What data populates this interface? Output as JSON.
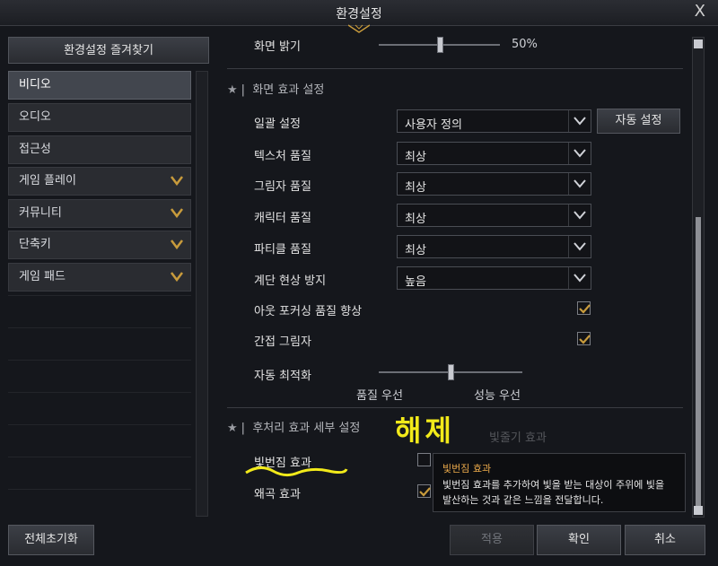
{
  "window": {
    "title": "환경설정",
    "close_glyph": "X"
  },
  "sidebar": {
    "favorites_button": "환경설정 즐겨찾기",
    "items": [
      {
        "label": "비디오",
        "active": true
      },
      {
        "label": "오디오",
        "active": false
      },
      {
        "label": "접근성",
        "active": false
      },
      {
        "label": "게임 플레이",
        "active": false,
        "has_chevron": true
      },
      {
        "label": "커뮤니티",
        "active": false,
        "has_chevron": true
      },
      {
        "label": "단축키",
        "active": false,
        "has_chevron": true
      },
      {
        "label": "게임 패드",
        "active": false,
        "has_chevron": true
      }
    ]
  },
  "main": {
    "brightness": {
      "label": "화면 밝기",
      "value_text": "50%",
      "value": 0.5
    },
    "screen_effects": {
      "heading": "화면 효과 설정",
      "batch": {
        "label": "일괄 설정",
        "value": "사용자 정의",
        "auto_button": "자동 설정"
      },
      "texture": {
        "label": "텍스처 품질",
        "value": "최상"
      },
      "shadow": {
        "label": "그림자 품질",
        "value": "최상"
      },
      "character": {
        "label": "캐릭터 품질",
        "value": "최상"
      },
      "particle": {
        "label": "파티클 품질",
        "value": "최상"
      },
      "antialias": {
        "label": "계단 현상 방지",
        "value": "높음"
      },
      "out_focus": {
        "label": "아웃 포커싱 품질 향상",
        "checked": true
      },
      "indirect_shadow": {
        "label": "간접 그림자",
        "checked": true
      },
      "auto_opt": {
        "label": "자동 최적화",
        "value": 0.5,
        "left_label": "품질 우선",
        "right_label": "성능 우선"
      }
    },
    "post_process": {
      "heading": "후처리 효과 세부 설정",
      "bloom": {
        "label": "빛번짐 효과",
        "checked": false
      },
      "bloom_hidden_label": "빛줄기 효과",
      "distortion": {
        "label": "왜곡 효과",
        "checked": true
      }
    }
  },
  "tooltip": {
    "title": "빛번짐 효과",
    "body_line1": "빛번짐 효과를 추가하여 빛을 받는 대상이 주위에 빛을",
    "body_line2": "발산하는 것과 같은 느낌을 전달합니다."
  },
  "annotation": {
    "text": "해제"
  },
  "bottom": {
    "reset": "전체초기화",
    "apply": "적용",
    "confirm": "확인",
    "cancel": "취소"
  },
  "colors": {
    "accent_gold": "#c89b3c",
    "annotation_yellow": "#f2ea1a",
    "tooltip_title": "#e8a84a"
  }
}
